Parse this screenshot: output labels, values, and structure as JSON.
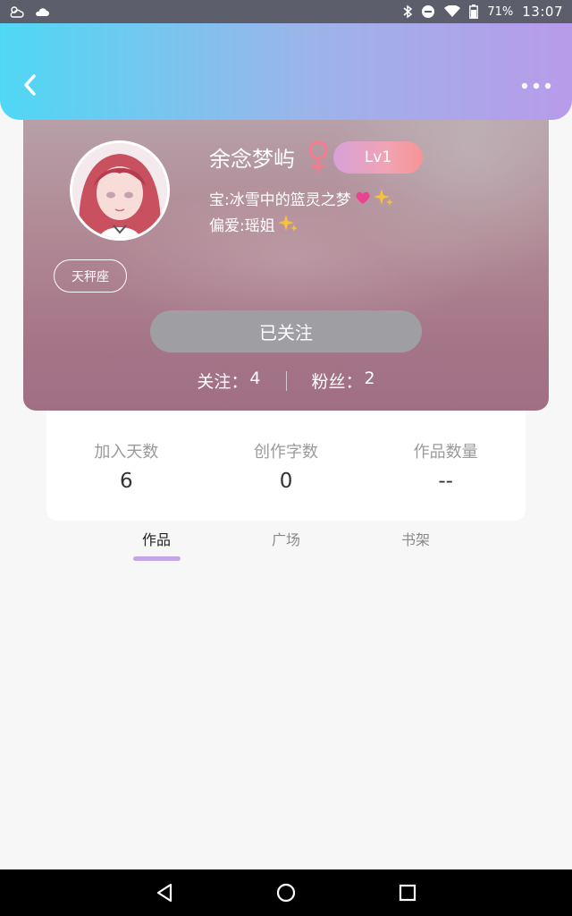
{
  "status_bar": {
    "battery": "71%",
    "time": "13:07",
    "icons": [
      "weather-icon",
      "cloud-icon",
      "bluetooth-icon",
      "dnd-icon",
      "wifi-icon",
      "battery-icon"
    ]
  },
  "header": {
    "back_icon": "chevron-left-icon",
    "more_icon": "more-dots-icon"
  },
  "profile": {
    "username": "余念梦屿",
    "gender_icon": "female-icon",
    "gender_color": "#f17d8f",
    "level": "Lv1",
    "bio_line1": "宝:冰雪中的篮灵之梦",
    "bio_line2": "偏爱:瑶姐",
    "constellation": "天秤座",
    "follow_button": "已关注",
    "following_label": "关注：",
    "following_count": "4",
    "fans_label": "粉丝：",
    "fans_count": "2"
  },
  "stats": [
    {
      "label": "加入天数",
      "value": "6"
    },
    {
      "label": "创作字数",
      "value": "0"
    },
    {
      "label": "作品数量",
      "value": "--"
    }
  ],
  "tabs": [
    {
      "label": "作品",
      "active": true
    },
    {
      "label": "广场",
      "active": false
    },
    {
      "label": "书架",
      "active": false
    }
  ],
  "colors": {
    "header_start": "#4fd8f4",
    "header_end": "#b89bea",
    "tab_indicator": "#c3a6e6",
    "level_badge": "#f0a3b3"
  }
}
